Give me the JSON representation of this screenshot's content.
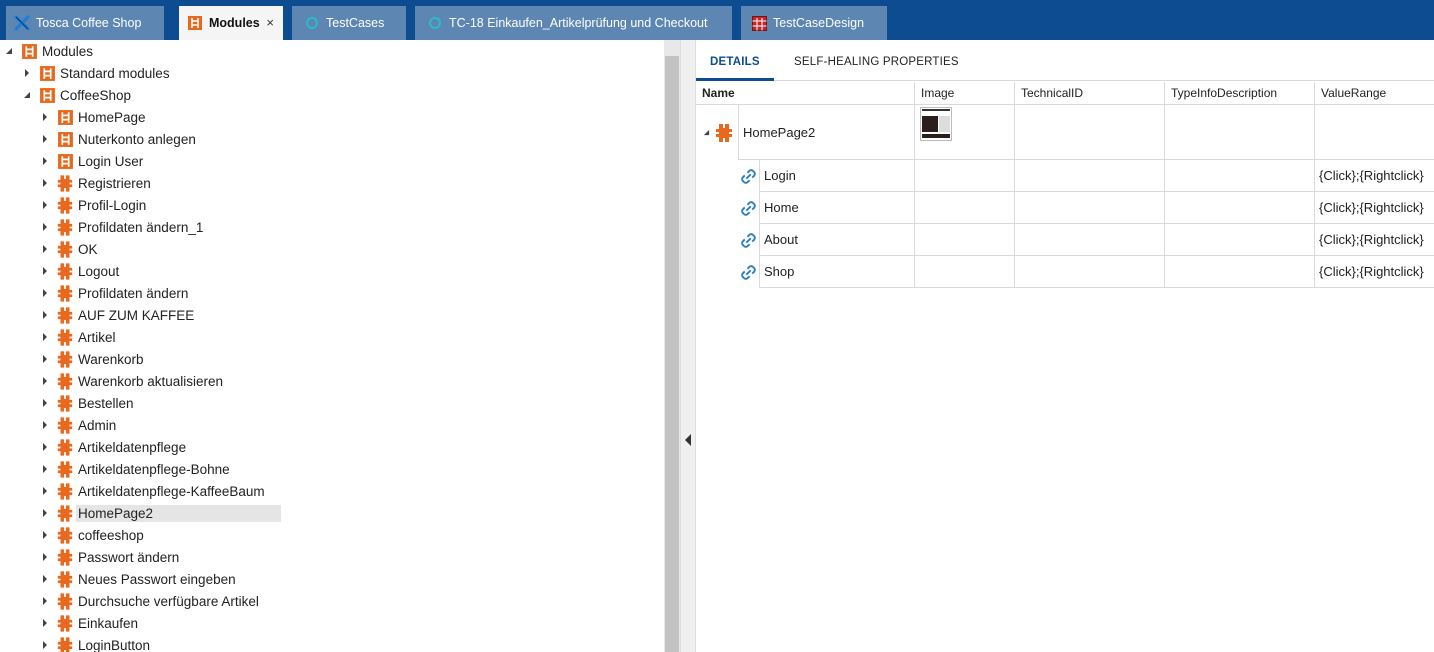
{
  "tabs": [
    {
      "label": "Tosca Coffee Shop",
      "icon": "tosca-logo-icon",
      "active": false
    },
    {
      "label": "Modules",
      "icon": "module-folder-icon",
      "active": true,
      "closable": true
    },
    {
      "label": "TestCases",
      "icon": "refresh-icon",
      "active": false
    },
    {
      "label": "TC-18 Einkaufen_Artikelprüfung und Checkout",
      "icon": "refresh-icon",
      "active": false
    },
    {
      "label": "TestCaseDesign",
      "icon": "grid-icon",
      "active": false
    }
  ],
  "tab_close_glyph": "×",
  "tree": {
    "root": "Modules",
    "children": [
      {
        "label": "Standard modules",
        "icon": "module-folder-icon"
      },
      {
        "label": "CoffeeShop",
        "icon": "module-folder-icon"
      }
    ],
    "coffeeshop_items": [
      {
        "label": "HomePage",
        "icon": "module-folder-icon"
      },
      {
        "label": "Nuterkonto anlegen",
        "icon": "module-folder-icon"
      },
      {
        "label": "Login User",
        "icon": "module-folder-icon"
      },
      {
        "label": "Registrieren",
        "icon": "module-icon"
      },
      {
        "label": "Profil-Login",
        "icon": "module-icon"
      },
      {
        "label": "Profildaten ändern_1",
        "icon": "module-icon"
      },
      {
        "label": "OK",
        "icon": "module-icon"
      },
      {
        "label": "Logout",
        "icon": "module-icon"
      },
      {
        "label": "Profildaten ändern",
        "icon": "module-icon"
      },
      {
        "label": "AUF ZUM KAFFEE",
        "icon": "module-icon"
      },
      {
        "label": "Artikel",
        "icon": "module-icon"
      },
      {
        "label": "Warenkorb",
        "icon": "module-icon"
      },
      {
        "label": "Warenkorb aktualisieren",
        "icon": "module-icon"
      },
      {
        "label": "Bestellen",
        "icon": "module-icon"
      },
      {
        "label": "Admin",
        "icon": "module-icon"
      },
      {
        "label": "Artikeldatenpflege",
        "icon": "module-icon"
      },
      {
        "label": "Artikeldatenpflege-Bohne",
        "icon": "module-icon"
      },
      {
        "label": "Artikeldatenpflege-KaffeeBaum",
        "icon": "module-icon"
      },
      {
        "label": "HomePage2",
        "icon": "module-icon",
        "selected": true
      },
      {
        "label": "coffeeshop",
        "icon": "module-icon"
      },
      {
        "label": "Passwort ändern",
        "icon": "module-icon"
      },
      {
        "label": "Neues Passwort eingeben",
        "icon": "module-icon"
      },
      {
        "label": "Durchsuche verfügbare Artikel",
        "icon": "module-icon"
      },
      {
        "label": "Einkaufen",
        "icon": "module-icon"
      },
      {
        "label": "LoginButton",
        "icon": "module-icon"
      }
    ]
  },
  "detail_tabs": {
    "details": "DETAILS",
    "self_healing": "SELF-HEALING PROPERTIES"
  },
  "grid": {
    "columns": [
      "Name",
      "Image",
      "TechnicalID",
      "TypeInfoDescription",
      "ValueRange"
    ],
    "module": {
      "name": "HomePage2",
      "icon": "module-icon"
    },
    "attributes": [
      {
        "name": "Login",
        "icon": "link-icon",
        "value_range": "{Click};{Rightclick}"
      },
      {
        "name": "Home",
        "icon": "link-icon",
        "value_range": "{Click};{Rightclick}"
      },
      {
        "name": "About",
        "icon": "link-icon",
        "value_range": "{Click};{Rightclick}"
      },
      {
        "name": "Shop",
        "icon": "link-icon",
        "value_range": "{Click};{Rightclick}"
      }
    ]
  },
  "colors": {
    "tabbar_bg": "#0e4c92",
    "tab_inactive_bg": "#5d86b3",
    "module_orange": "#e8691d",
    "link_blue": "#2a7fc8",
    "selection_bg": "#e5e5e5"
  }
}
